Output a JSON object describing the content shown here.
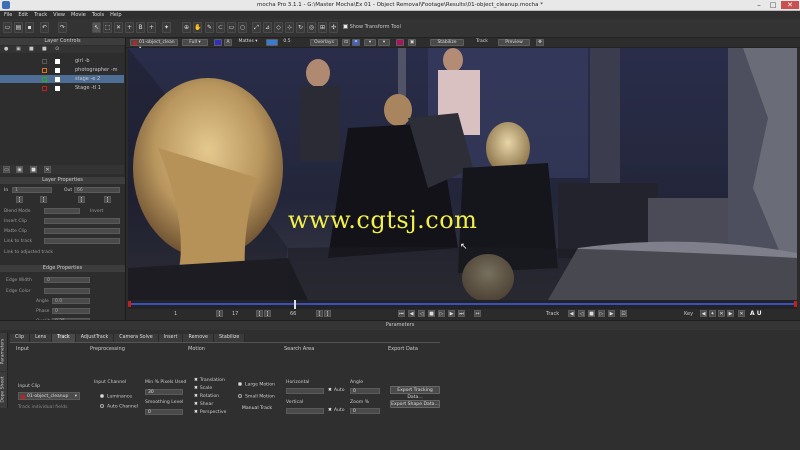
{
  "window": {
    "title": "mocha Pro 3.1.1 - G:\\Master Mocha\\Ex 01 - Object Removal\\Footage\\Results\\01-object_cleanup.mocha *"
  },
  "menu": [
    "File",
    "Edit",
    "Track",
    "View",
    "Movie",
    "Tools",
    "Help"
  ],
  "toolbar": {
    "show_transform_tool": "Show Transform Tool"
  },
  "viewer_bar": {
    "clip": "01-object_clean",
    "view": "Full",
    "mattes": "Mattes",
    "zoom": "0.5",
    "overlays": "Overlays",
    "stabilize": "Stabilize",
    "track": "Track",
    "preview": "Preview"
  },
  "layer_controls": {
    "title": "Layer Controls",
    "layers": [
      {
        "name": "girl -b",
        "color": "#5a5a5a"
      },
      {
        "name": "photographer -m",
        "color": "#e07020"
      },
      {
        "name": "stage -e 2",
        "color": "#2ea82e"
      },
      {
        "name": "Stage -tl 1",
        "color": "#c02020"
      }
    ]
  },
  "layer_properties": {
    "title": "Layer Properties",
    "in_label": "In",
    "in_value": "1",
    "out_label": "Out",
    "out_value": "66",
    "blend_mode": "Blend Mode",
    "invert": "Invert",
    "insert_clip": "Insert Clip",
    "matte_clip": "Matte Clip",
    "link_to_track": "Link to track",
    "link_adjusted": "Link to adjusted track"
  },
  "edge_properties": {
    "title": "Edge Properties",
    "edge_width": "Edge Width",
    "edge_color": "Edge Color",
    "angle": "Angle",
    "phase": "Phase",
    "quality": "Quality",
    "quality_value": "0.25",
    "zero": "0",
    "zero_point": "0.0"
  },
  "watermark": "www.cgtsj.com",
  "timeline": {
    "frame_start": "1",
    "frame_a": "17",
    "frame_current": "66",
    "track_label": "Track",
    "key_label": "Key",
    "auto_label": "A U"
  },
  "parameters": {
    "title": "Parameters",
    "side_tabs": [
      "Parameters",
      "Dope Sheet"
    ],
    "tabs": [
      "Clip",
      "Lens",
      "Track",
      "AdjustTrack",
      "Camera Solve",
      "Insert",
      "Remove",
      "Stabilize"
    ],
    "active_tab": "Track",
    "sections": {
      "input": "Input",
      "preprocessing": "Preprocessing",
      "motion": "Motion",
      "search_area": "Search Area",
      "export_data": "Export Data"
    },
    "input_clip_label": "Input Clip",
    "input_clip_value": "01-object_cleanup",
    "track_individual": "Track individual fields",
    "input_channel_label": "Input Channel",
    "luminance": "Luminance",
    "auto_channel": "Auto Channel",
    "min_pixels_label": "Min % Pixels Used",
    "min_pixels_value": "30",
    "smoothing_label": "Smoothing Level",
    "smoothing_value": "0",
    "motion_options": [
      "Translation",
      "Scale",
      "Rotation",
      "Shear",
      "Perspective"
    ],
    "motion_types": [
      "Large Motion",
      "Small Motion",
      "Manual Track"
    ],
    "horizontal": "Horizontal",
    "vertical": "Vertical",
    "auto": "Auto",
    "angle_label": "Angle",
    "angle_value": "0",
    "zoom_label": "Zoom %",
    "zoom_value": "0",
    "export_tracking": "Export Tracking Data...",
    "export_shape": "Export Shape Data..."
  }
}
